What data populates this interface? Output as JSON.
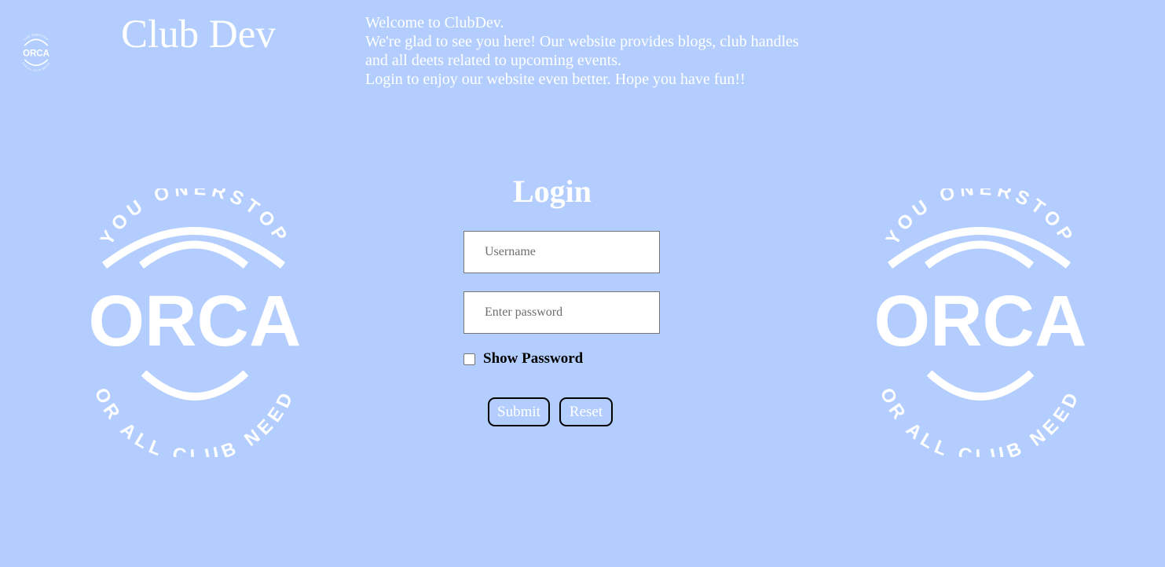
{
  "header": {
    "logo": {
      "top_text": "THE ONESTOP",
      "brand": "ORCA",
      "bottom_text": "FOR ALL CLUB NEEDS"
    },
    "title": "Club Dev",
    "welcome_lines": [
      "Welcome to ClubDev.",
      "We're glad to see you here! Our website provides blogs, club handles",
      "and all deets related to upcoming events.",
      "Login to enjoy our website even better. Hope you have fun!!"
    ]
  },
  "side_logo": {
    "top_text": "YOU ONERSTOP",
    "brand": "ORCA",
    "bottom_text": "FOR ALL CLUB NEEDS"
  },
  "login": {
    "title": "Login",
    "username_placeholder": "Username",
    "username_value": "",
    "password_placeholder": "Enter password",
    "password_value": "",
    "show_password_label": "Show Password",
    "show_password_checked": false,
    "submit_label": "Submit",
    "reset_label": "Reset"
  },
  "colors": {
    "background": "#b3cefe",
    "text": "#ffffff",
    "button_border": "#000000"
  }
}
